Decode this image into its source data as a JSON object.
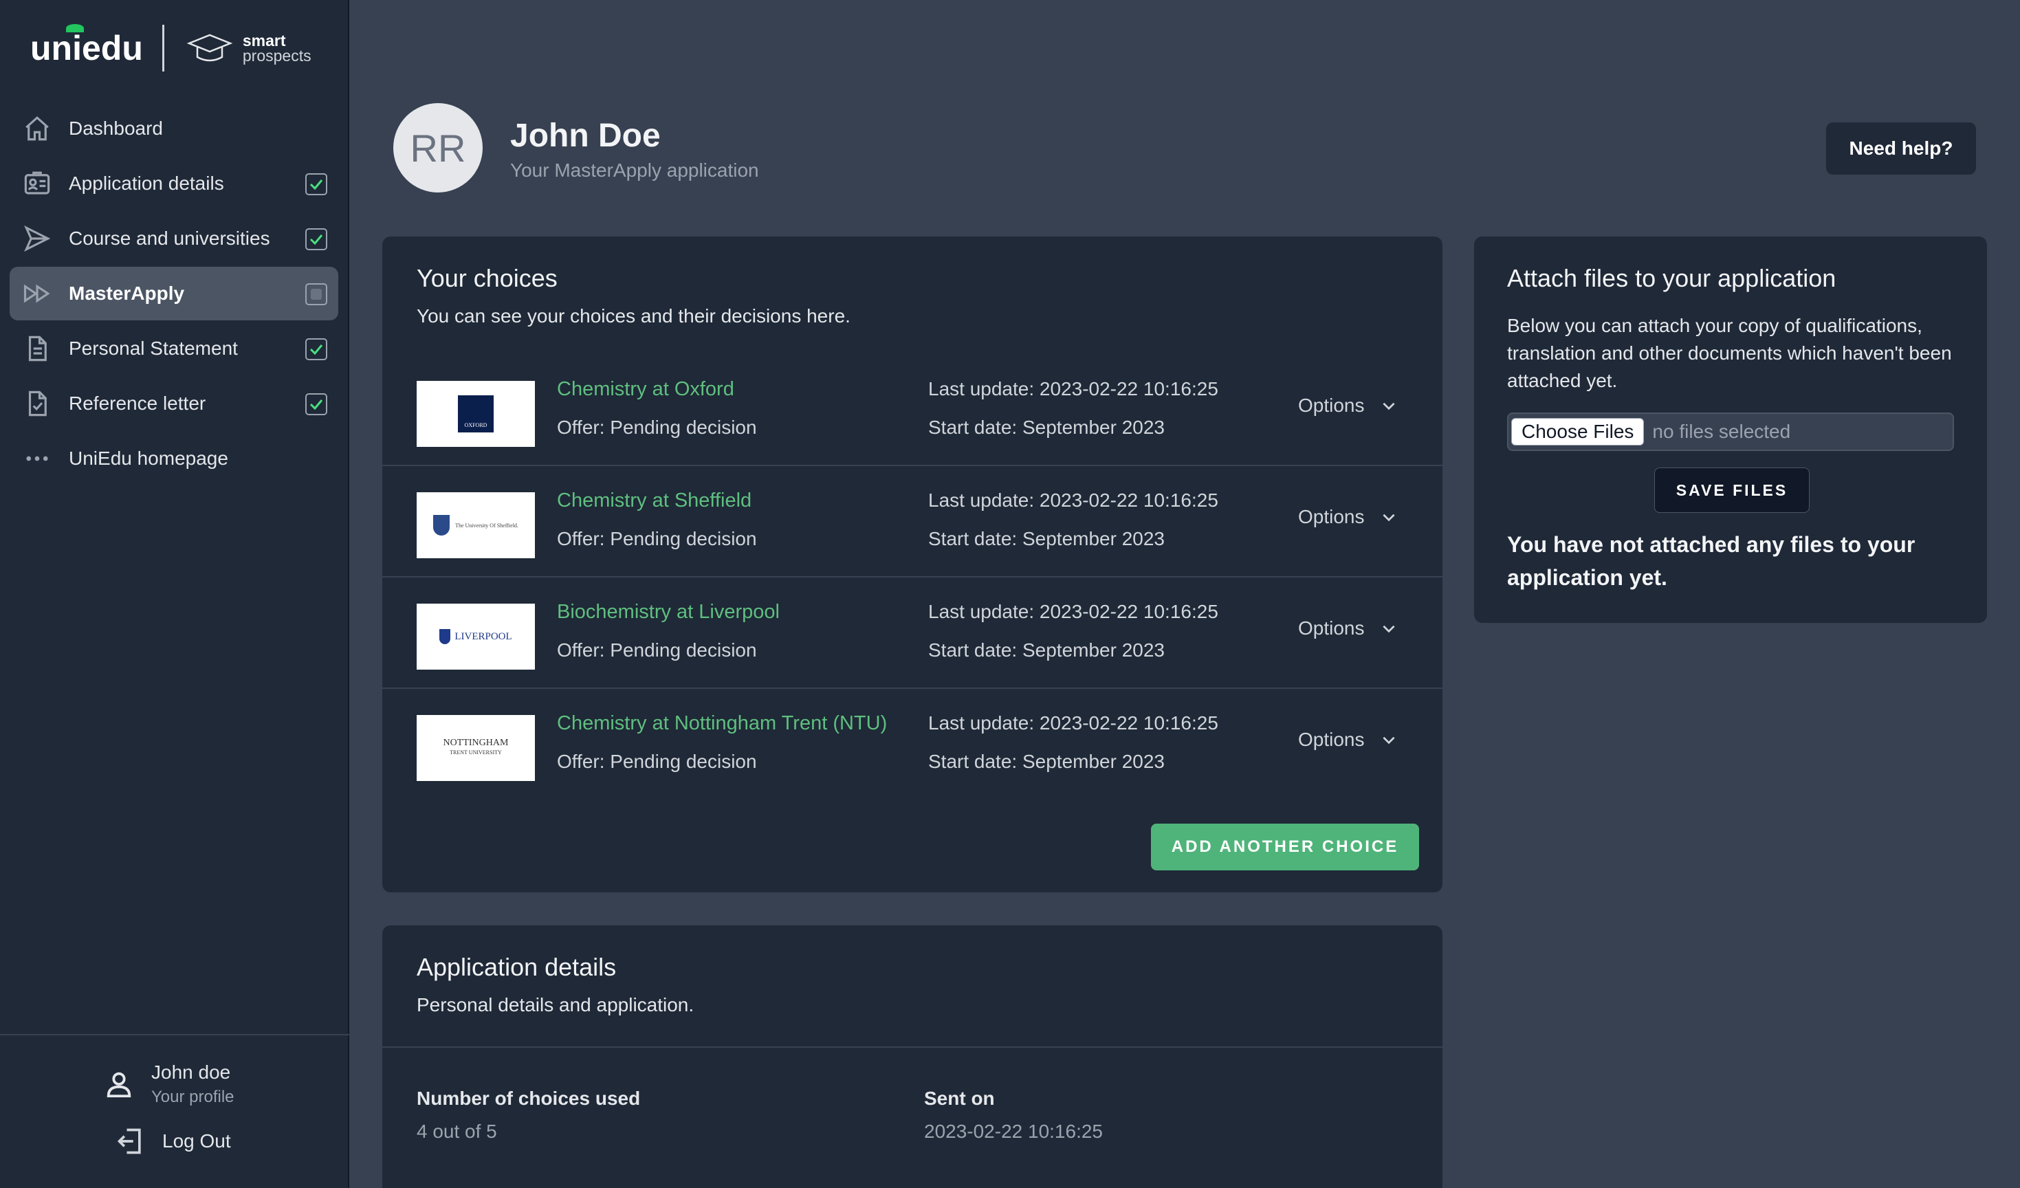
{
  "brand": {
    "logo": "uniedu",
    "partner_line1": "smart",
    "partner_line2": "prospects"
  },
  "nav": [
    {
      "label": "Dashboard",
      "icon": "home-icon",
      "status": "none"
    },
    {
      "label": "Application details",
      "icon": "id-card-icon",
      "status": "done"
    },
    {
      "label": "Course and universities",
      "icon": "send-icon",
      "status": "done"
    },
    {
      "label": "MasterApply",
      "icon": "forward-icon",
      "status": "partial",
      "active": true
    },
    {
      "label": "Personal Statement",
      "icon": "document-icon",
      "status": "done"
    },
    {
      "label": "Reference letter",
      "icon": "document-check-icon",
      "status": "done"
    },
    {
      "label": "UniEdu homepage",
      "icon": "more-dots-icon",
      "status": "none"
    }
  ],
  "profile": {
    "name": "John doe",
    "sub": "Your profile",
    "logout": "Log Out"
  },
  "header": {
    "initials": "RR",
    "name": "John Doe",
    "subtitle": "Your MasterApply application",
    "help": "Need help?"
  },
  "choices": {
    "title": "Your choices",
    "subtitle": "You can see your choices and their decisions here.",
    "options_label": "Options",
    "add_label": "ADD ANOTHER CHOICE",
    "items": [
      {
        "course": "Chemistry at Oxford",
        "offer": "Offer: Pending decision",
        "last_update": "Last update: 2023-02-22 10:16:25",
        "start": "Start date: September 2023",
        "logo_text": "OXFORD"
      },
      {
        "course": "Chemistry at Sheffield",
        "offer": "Offer: Pending decision",
        "last_update": "Last update: 2023-02-22 10:16:25",
        "start": "Start date: September 2023",
        "logo_text": "The University Of Sheffield."
      },
      {
        "course": "Biochemistry at Liverpool",
        "offer": "Offer: Pending decision",
        "last_update": "Last update: 2023-02-22 10:16:25",
        "start": "Start date: September 2023",
        "logo_text": "LIVERPOOL"
      },
      {
        "course": "Chemistry at Nottingham Trent (NTU)",
        "offer": "Offer: Pending decision",
        "last_update": "Last update: 2023-02-22 10:16:25",
        "start": "Start date: September 2023",
        "logo_text": "NOTTINGHAM",
        "logo_sub": "TRENT UNIVERSITY"
      }
    ]
  },
  "details": {
    "title": "Application details",
    "subtitle": "Personal details and application.",
    "choices_used_label": "Number of choices used",
    "choices_used_value": "4 out of 5",
    "sent_label": "Sent on",
    "sent_value": "2023-02-22 10:16:25"
  },
  "files": {
    "title": "Attach files to your application",
    "description": "Below you can attach your copy of qualifications, translation and other documents which haven't been attached yet.",
    "choose_label": "Choose Files",
    "no_files": "no files selected",
    "save_label": "SAVE FILES",
    "note": "You have not attached any files to your application yet."
  },
  "colors": {
    "page_bg": "#374151",
    "card_bg": "#1f2937",
    "accent_green": "#4fb47a",
    "check_green": "#4ade80"
  }
}
